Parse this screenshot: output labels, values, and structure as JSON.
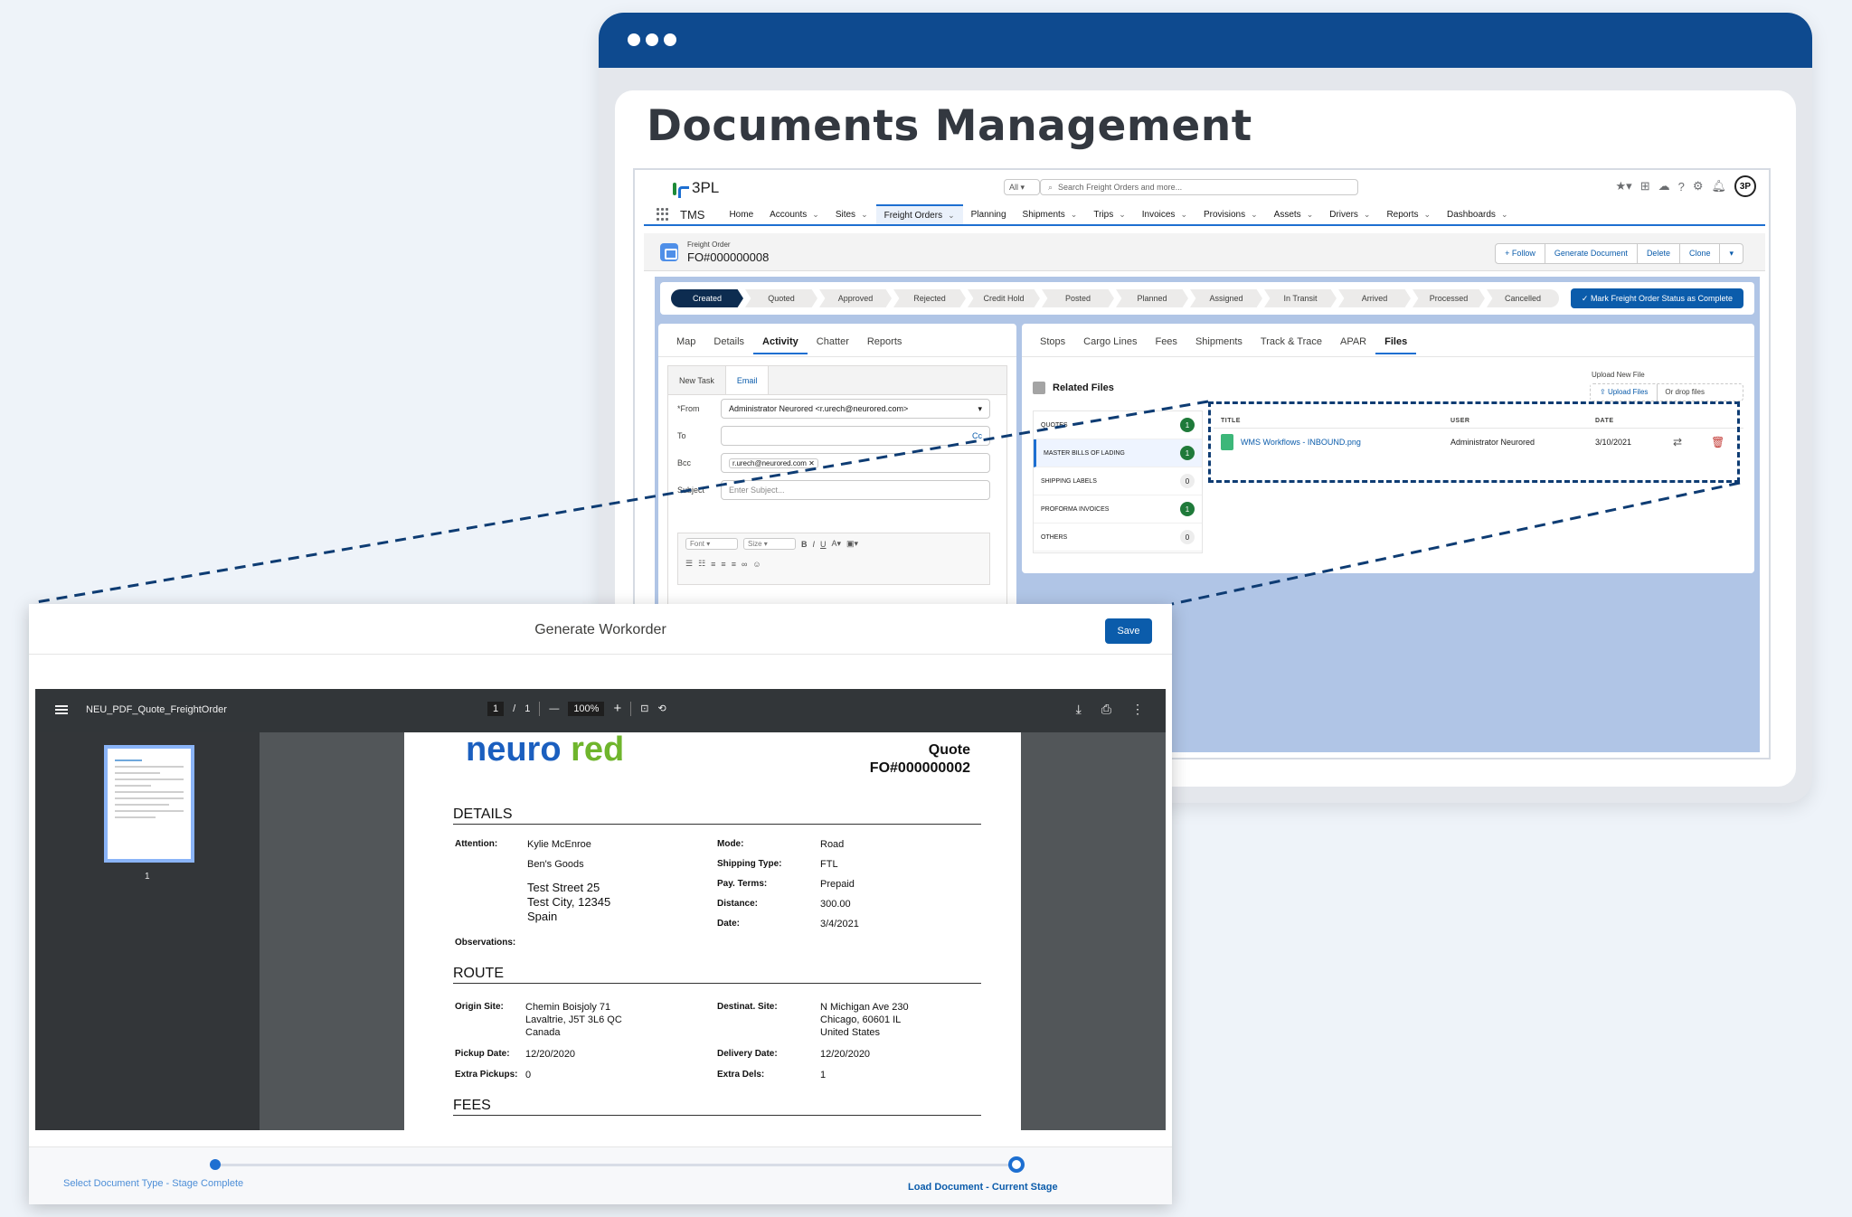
{
  "hero": {
    "title": "Documents Management"
  },
  "app": {
    "brand": "3PL",
    "app_name": "TMS",
    "search_scope": "All",
    "search_placeholder": "Search Freight Orders and more...",
    "avatar": "3P",
    "nav": [
      "Home",
      "Accounts",
      "Sites",
      "Freight Orders",
      "Planning",
      "Shipments",
      "Trips",
      "Invoices",
      "Provisions",
      "Assets",
      "Drivers",
      "Reports",
      "Dashboards"
    ],
    "record": {
      "type": "Freight Order",
      "name": "FO#000000008",
      "actions": [
        "Follow",
        "Generate Document",
        "Delete",
        "Clone"
      ]
    },
    "path": [
      "Created",
      "Quoted",
      "Approved",
      "Rejected",
      "Credit Hold",
      "Posted",
      "Planned",
      "Assigned",
      "In Transit",
      "Arrived",
      "Processed",
      "Cancelled"
    ],
    "mark_complete": "Mark Freight Order Status as Complete",
    "left_tabs": [
      "Map",
      "Details",
      "Activity",
      "Chatter",
      "Reports"
    ],
    "publisher": {
      "tabs": [
        "New Task",
        "Email"
      ],
      "from_label": "*From",
      "from_value": "Administrator Neurored <r.urech@neurored.com>",
      "to_label": "To",
      "cc": "Cc",
      "bcc_label": "Bcc",
      "bcc_value": "r.urech@neurored.com",
      "subject_label": "Subject",
      "subject_placeholder": "Enter Subject...",
      "font": "Font",
      "size": "Size"
    },
    "right_tabs": [
      "Stops",
      "Cargo Lines",
      "Fees",
      "Shipments",
      "Track & Trace",
      "APAR",
      "Files"
    ],
    "related_files": {
      "title": "Related Files",
      "upload_label": "Upload New File",
      "upload_btn": "Upload Files",
      "drop": "Or drop files",
      "categories": [
        {
          "name": "QUOTES",
          "count": "1"
        },
        {
          "name": "MASTER BILLS OF LADING",
          "count": "1"
        },
        {
          "name": "SHIPPING LABELS",
          "count": "0"
        },
        {
          "name": "PROFORMA INVOICES",
          "count": "1"
        },
        {
          "name": "OTHERS",
          "count": "0"
        }
      ],
      "columns": [
        "TITLE",
        "USER",
        "DATE"
      ],
      "rows": [
        {
          "title": "WMS Workflows - INBOUND.png",
          "user": "Administrator Neurored",
          "date": "3/10/2021"
        }
      ]
    }
  },
  "modal": {
    "title": "Generate Workorder",
    "save": "Save",
    "pdf": {
      "file_name": "NEU_PDF_Quote_FreightOrder",
      "page": "1",
      "page_sep": "/",
      "pages": "1",
      "zoom": "100%",
      "thumb_no": "1"
    },
    "doc": {
      "logo_a": "neuro",
      "logo_b": " red",
      "quote": "Quote",
      "number": "FO#000000002",
      "details_h": "DETAILS",
      "attention_l": "Attention:",
      "attention_v": "Kylie McEnroe",
      "company": "Ben's Goods",
      "addr1": "Test Street 25",
      "addr2": "Test City, 12345",
      "addr3": "Spain",
      "observations_l": "Observations:",
      "mode_l": "Mode:",
      "mode_v": "Road",
      "shiptype_l": "Shipping Type:",
      "shiptype_v": "FTL",
      "payterms_l": "Pay. Terms:",
      "payterms_v": "Prepaid",
      "distance_l": "Distance:",
      "distance_v": "300.00",
      "date_l": "Date:",
      "date_v": "3/4/2021",
      "route_h": "ROUTE",
      "origin_l": "Origin Site:",
      "origin_1": "Chemin Boisjoly 71",
      "origin_2": "Lavaltrie, J5T 3L6 QC",
      "origin_3": "Canada",
      "dest_l": "Destinat. Site:",
      "dest_1": "N Michigan Ave 230",
      "dest_2": "Chicago, 60601 IL",
      "dest_3": "United States",
      "pickup_l": "Pickup Date:",
      "pickup_v": "12/20/2020",
      "delivery_l": "Delivery Date:",
      "delivery_v": "12/20/2020",
      "xpick_l": "Extra Pickups:",
      "xpick_v": "0",
      "xdel_l": "Extra Dels:",
      "xdel_v": "1",
      "fees_h": "FEES"
    },
    "stepper": {
      "step1": "Select Document Type - Stage Complete",
      "step2": "Load Document - Current Stage"
    }
  },
  "colors": {
    "brand_blue": "#0e4a8f",
    "accent": "#0b5cab",
    "logo_green": "#6fb52c"
  }
}
